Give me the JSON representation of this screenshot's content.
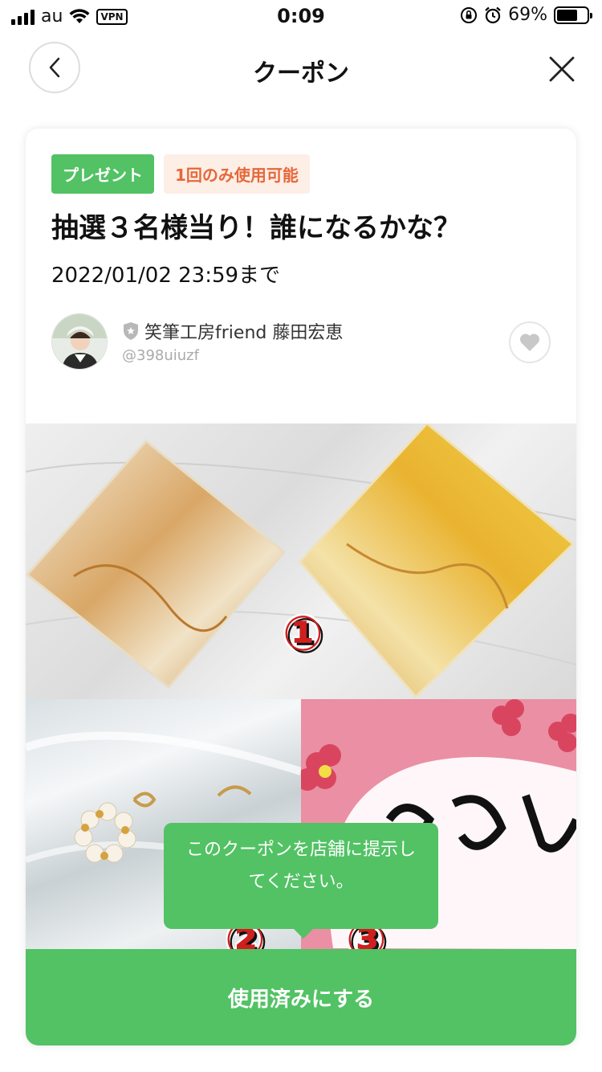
{
  "status_bar": {
    "carrier": "au",
    "vpn_label": "VPN",
    "time": "0:09",
    "battery": "69%"
  },
  "nav": {
    "title": "クーポン"
  },
  "coupon": {
    "tag_present": "プレゼント",
    "tag_once": "1回のみ使用可能",
    "title": "抽選３名様当り！誰になるかな？",
    "deadline": "2022/01/02 23:59まで",
    "account_name": "笑筆工房friend 藤田宏恵",
    "account_id": "@398uiuzf",
    "image_labels": [
      "①",
      "②",
      "③"
    ]
  },
  "tooltip": {
    "text": "このクーポンを店舗に提示してください。"
  },
  "actions": {
    "use_button": "使用済みにする"
  }
}
